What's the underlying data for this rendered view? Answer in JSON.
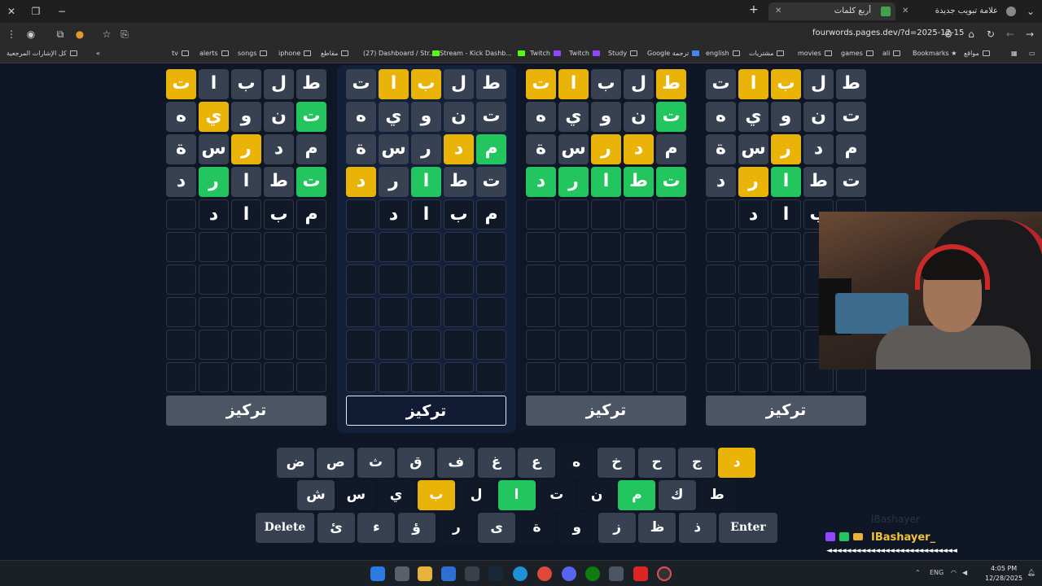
{
  "browser": {
    "tabs": [
      {
        "label": "أربع كلمات",
        "active": true
      },
      {
        "label": "علامة تبويب جديدة",
        "active": false
      }
    ],
    "url": "fourwords.pages.dev/?d=2025-12-15",
    "bookmarks": [
      "كل الإشارات المرجعية",
      "tv",
      "alerts",
      "songs",
      "iphone",
      "مقاطع",
      "(27) Dashboard / Str...",
      "Stream - Kick Dashb...",
      "Twitch",
      "Twitch",
      "Study",
      "Google ترجمة",
      "english",
      "مشتريات",
      "movies",
      "games",
      "ali",
      "Bookmarks",
      "مواقع"
    ]
  },
  "game": {
    "boards": [
      {
        "rows": [
          [
            {
              "l": "ت",
              "s": "y"
            },
            {
              "l": "ا",
              "s": "n"
            },
            {
              "l": "ب",
              "s": "n"
            },
            {
              "l": "ل",
              "s": "n"
            },
            {
              "l": "ط",
              "s": "n"
            }
          ],
          [
            {
              "l": "ه",
              "s": "n"
            },
            {
              "l": "ي",
              "s": "y"
            },
            {
              "l": "و",
              "s": "n"
            },
            {
              "l": "ن",
              "s": "n"
            },
            {
              "l": "ت",
              "s": "g"
            }
          ],
          [
            {
              "l": "ة",
              "s": "n"
            },
            {
              "l": "س",
              "s": "n"
            },
            {
              "l": "ر",
              "s": "y"
            },
            {
              "l": "د",
              "s": "n"
            },
            {
              "l": "م",
              "s": "n"
            }
          ],
          [
            {
              "l": "د",
              "s": "n"
            },
            {
              "l": "ر",
              "s": "g"
            },
            {
              "l": "ا",
              "s": "n"
            },
            {
              "l": "ط",
              "s": "n"
            },
            {
              "l": "ت",
              "s": "g"
            }
          ],
          [
            {
              "l": "",
              "s": "c"
            },
            {
              "l": "د",
              "s": "c"
            },
            {
              "l": "ا",
              "s": "c"
            },
            {
              "l": "ب",
              "s": "c"
            },
            {
              "l": "م",
              "s": "c"
            }
          ]
        ]
      },
      {
        "rows": [
          [
            {
              "l": "ت",
              "s": "n"
            },
            {
              "l": "ا",
              "s": "y"
            },
            {
              "l": "ب",
              "s": "y"
            },
            {
              "l": "ل",
              "s": "n"
            },
            {
              "l": "ط",
              "s": "n"
            }
          ],
          [
            {
              "l": "ه",
              "s": "n"
            },
            {
              "l": "ي",
              "s": "n"
            },
            {
              "l": "و",
              "s": "n"
            },
            {
              "l": "ن",
              "s": "n"
            },
            {
              "l": "ت",
              "s": "n"
            }
          ],
          [
            {
              "l": "ة",
              "s": "n"
            },
            {
              "l": "س",
              "s": "n"
            },
            {
              "l": "ر",
              "s": "n"
            },
            {
              "l": "د",
              "s": "y"
            },
            {
              "l": "م",
              "s": "g"
            }
          ],
          [
            {
              "l": "د",
              "s": "y"
            },
            {
              "l": "ر",
              "s": "n"
            },
            {
              "l": "ا",
              "s": "g"
            },
            {
              "l": "ط",
              "s": "n"
            },
            {
              "l": "ت",
              "s": "n"
            }
          ],
          [
            {
              "l": "",
              "s": "c"
            },
            {
              "l": "د",
              "s": "c"
            },
            {
              "l": "ا",
              "s": "c"
            },
            {
              "l": "ب",
              "s": "c"
            },
            {
              "l": "م",
              "s": "c"
            }
          ]
        ]
      },
      {
        "rows": [
          [
            {
              "l": "ت",
              "s": "y"
            },
            {
              "l": "ا",
              "s": "y"
            },
            {
              "l": "ب",
              "s": "n"
            },
            {
              "l": "ل",
              "s": "n"
            },
            {
              "l": "ط",
              "s": "y"
            }
          ],
          [
            {
              "l": "ه",
              "s": "n"
            },
            {
              "l": "ي",
              "s": "n"
            },
            {
              "l": "و",
              "s": "n"
            },
            {
              "l": "ن",
              "s": "n"
            },
            {
              "l": "ت",
              "s": "g"
            }
          ],
          [
            {
              "l": "ة",
              "s": "n"
            },
            {
              "l": "س",
              "s": "n"
            },
            {
              "l": "ر",
              "s": "y"
            },
            {
              "l": "د",
              "s": "y"
            },
            {
              "l": "م",
              "s": "n"
            }
          ],
          [
            {
              "l": "د",
              "s": "g"
            },
            {
              "l": "ر",
              "s": "g"
            },
            {
              "l": "ا",
              "s": "g"
            },
            {
              "l": "ط",
              "s": "g"
            },
            {
              "l": "ت",
              "s": "g"
            }
          ],
          [
            {
              "l": "",
              "s": "c"
            },
            {
              "l": "",
              "s": "c"
            },
            {
              "l": "",
              "s": "c"
            },
            {
              "l": "",
              "s": "c"
            },
            {
              "l": "",
              "s": "c"
            }
          ]
        ]
      },
      {
        "rows": [
          [
            {
              "l": "ت",
              "s": "n"
            },
            {
              "l": "ا",
              "s": "y"
            },
            {
              "l": "ب",
              "s": "y"
            },
            {
              "l": "ل",
              "s": "n"
            },
            {
              "l": "ط",
              "s": "n"
            }
          ],
          [
            {
              "l": "ه",
              "s": "n"
            },
            {
              "l": "ي",
              "s": "n"
            },
            {
              "l": "و",
              "s": "n"
            },
            {
              "l": "ن",
              "s": "n"
            },
            {
              "l": "ت",
              "s": "n"
            }
          ],
          [
            {
              "l": "ة",
              "s": "n"
            },
            {
              "l": "س",
              "s": "n"
            },
            {
              "l": "ر",
              "s": "y"
            },
            {
              "l": "د",
              "s": "n"
            },
            {
              "l": "م",
              "s": "n"
            }
          ],
          [
            {
              "l": "د",
              "s": "n"
            },
            {
              "l": "ر",
              "s": "y"
            },
            {
              "l": "ا",
              "s": "g"
            },
            {
              "l": "ط",
              "s": "n"
            },
            {
              "l": "ت",
              "s": "n"
            }
          ],
          [
            {
              "l": "",
              "s": "c"
            },
            {
              "l": "د",
              "s": "c"
            },
            {
              "l": "ا",
              "s": "c"
            },
            {
              "l": "ب",
              "s": "c"
            },
            {
              "l": "",
              "s": "c"
            }
          ]
        ]
      }
    ],
    "focus_label": "تركيز",
    "keyboard": {
      "row1": [
        {
          "k": "ض"
        },
        {
          "k": "ص"
        },
        {
          "k": "ث"
        },
        {
          "k": "ق"
        },
        {
          "k": "ف"
        },
        {
          "k": "غ"
        },
        {
          "k": "ع"
        },
        {
          "k": "ه",
          "s": "d"
        },
        {
          "k": "خ"
        },
        {
          "k": "ح"
        },
        {
          "k": "ج"
        },
        {
          "k": "د",
          "s": "y"
        }
      ],
      "row2": [
        {
          "k": "ش"
        },
        {
          "k": "س",
          "s": "d"
        },
        {
          "k": "ي",
          "s": "d"
        },
        {
          "k": "ب",
          "s": "y"
        },
        {
          "k": "ل",
          "s": "d"
        },
        {
          "k": "ا",
          "s": "g"
        },
        {
          "k": "ت",
          "s": "d"
        },
        {
          "k": "ن",
          "s": "d"
        },
        {
          "k": "م",
          "s": "g"
        },
        {
          "k": "ك"
        },
        {
          "k": "ط",
          "s": "d"
        }
      ],
      "row3": [
        {
          "k": "ئ"
        },
        {
          "k": "ء"
        },
        {
          "k": "ؤ"
        },
        {
          "k": "ر",
          "s": "d"
        },
        {
          "k": "ى"
        },
        {
          "k": "ة",
          "s": "d"
        },
        {
          "k": "و",
          "s": "d"
        },
        {
          "k": "ز"
        },
        {
          "k": "ظ"
        },
        {
          "k": "ذ"
        }
      ],
      "delete_label": "Delete",
      "enter_label": "Enter"
    }
  },
  "chat": {
    "username": "IBashayer_",
    "ghost_username": "IBashayer"
  },
  "taskbar": {
    "time": "4:05 PM",
    "date": "12/28/2025"
  },
  "colors": {
    "green": "#22c55e",
    "yellow": "#eab308",
    "gray": "#374151",
    "dark": "#111827"
  }
}
